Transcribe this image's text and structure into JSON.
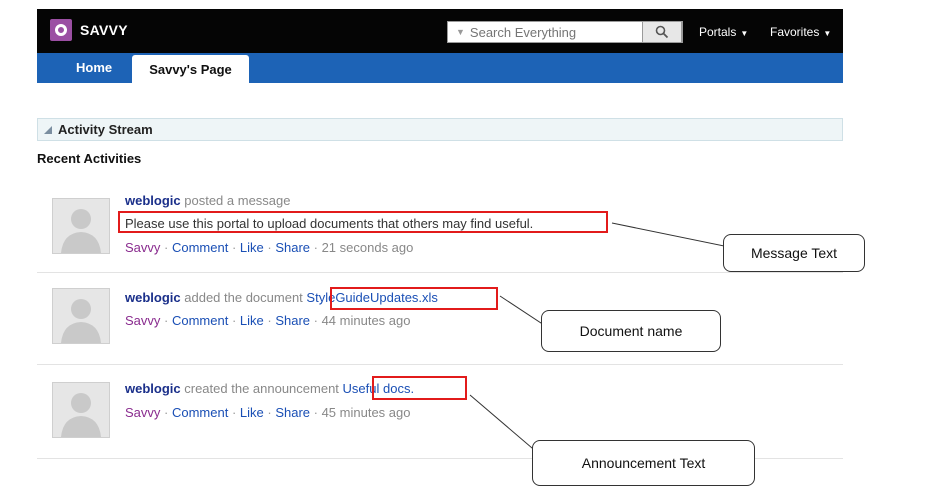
{
  "header": {
    "app_title": "SAVVY",
    "search_placeholder": "Search Everything",
    "nav": [
      "Portals",
      "Favorites"
    ]
  },
  "tabs": {
    "home": "Home",
    "active": "Savvy's Page"
  },
  "stream": {
    "title": "Activity Stream",
    "recent_title": "Recent Activities"
  },
  "activities": [
    {
      "user": "weblogic",
      "verb": "posted a message",
      "message": "Please use this portal to upload documents that others may find useful.",
      "actions": {
        "owner": "Savvy",
        "comment": "Comment",
        "like": "Like",
        "share": "Share",
        "time": "21 seconds ago"
      }
    },
    {
      "user": "weblogic",
      "verb": "added the document",
      "target": "StyleGuideUpdates.xls",
      "actions": {
        "owner": "Savvy",
        "comment": "Comment",
        "like": "Like",
        "share": "Share",
        "time": "44 minutes ago"
      }
    },
    {
      "user": "weblogic",
      "verb": "created the announcement",
      "target": "Useful docs.",
      "actions": {
        "owner": "Savvy",
        "comment": "Comment",
        "like": "Like",
        "share": "Share",
        "time": "45 minutes ago"
      }
    }
  ],
  "callouts": {
    "message": "Message Text",
    "document": "Document name",
    "announcement": "Announcement Text"
  },
  "colors": {
    "topbar": "#050505",
    "tabbar": "#1d63b6",
    "highlight": "#e21b1b",
    "link": "#1a4fb5",
    "user": "#1a2f8a"
  }
}
